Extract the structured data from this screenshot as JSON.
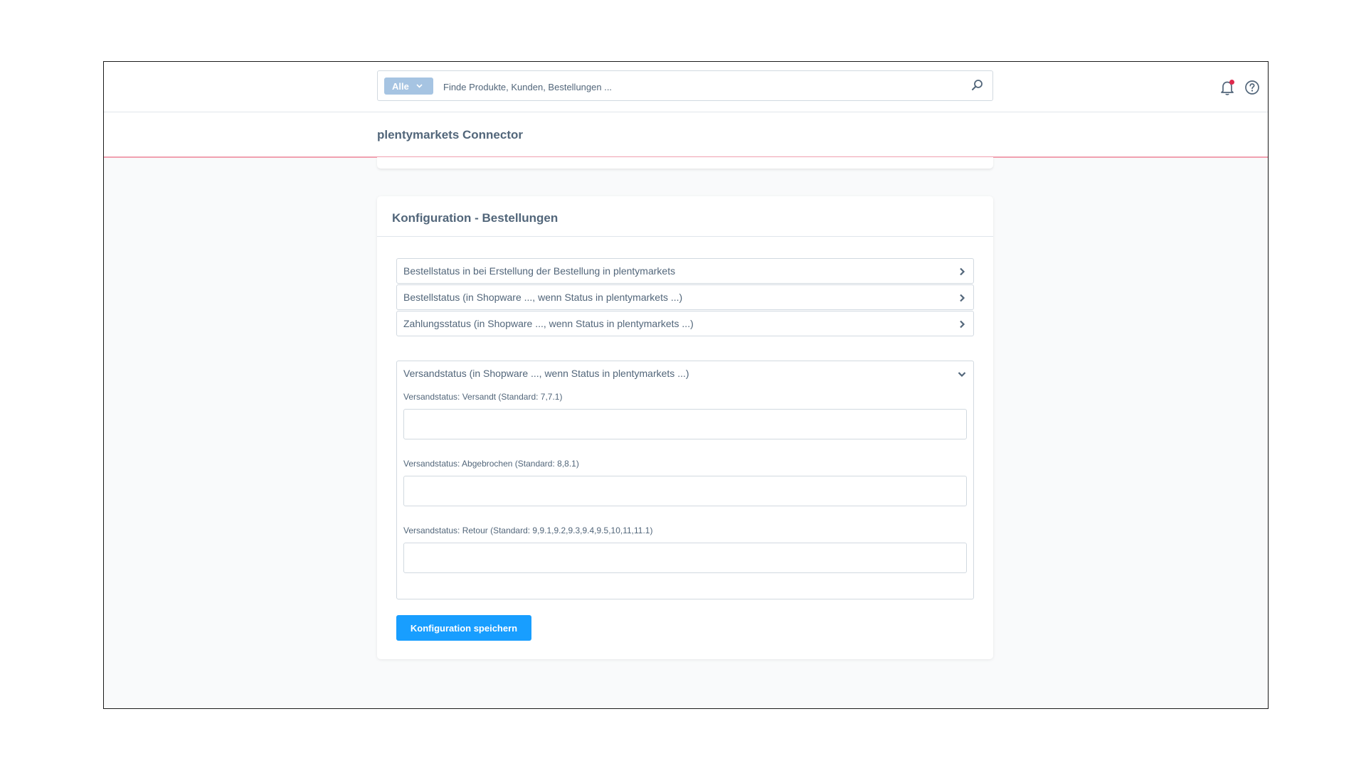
{
  "search": {
    "type_label": "Alle",
    "placeholder": "Finde Produkte, Kunden, Bestellungen ..."
  },
  "header": {
    "title": "plentymarkets Connector"
  },
  "card": {
    "title": "Konfiguration - Bestellungen",
    "sections": [
      {
        "label": "Bestellstatus in bei Erstellung der Bestellung in plentymarkets",
        "expanded": false
      },
      {
        "label": "Bestellstatus (in Shopware ..., wenn Status in plentymarkets ...)",
        "expanded": false
      },
      {
        "label": "Zahlungsstatus (in Shopware ..., wenn Status in plentymarkets ...)",
        "expanded": false
      },
      {
        "label": "Versandstatus (in Shopware ..., wenn Status in plentymarkets ...)",
        "expanded": true
      }
    ],
    "fields": [
      {
        "label": "Versandstatus: Versandt (Standard: 7,7.1)",
        "value": ""
      },
      {
        "label": "Versandstatus: Abgebrochen (Standard: 8,8.1)",
        "value": ""
      },
      {
        "label": "Versandstatus: Retour (Standard: 9,9.1,9.2,9.3,9.4,9.5,10,11,11.1)",
        "value": ""
      }
    ],
    "save_label": "Konfiguration speichern"
  },
  "colors": {
    "accent": "#189eff",
    "search_type_bg": "#a6c4e2",
    "notification_dot": "#de294c",
    "smartbar_border": "#f1a1b0"
  },
  "icons": {
    "search": "search-icon",
    "notifications": "bell-icon",
    "help": "help-icon",
    "collapsed": "chevron-right-icon",
    "expanded": "chevron-down-icon"
  }
}
